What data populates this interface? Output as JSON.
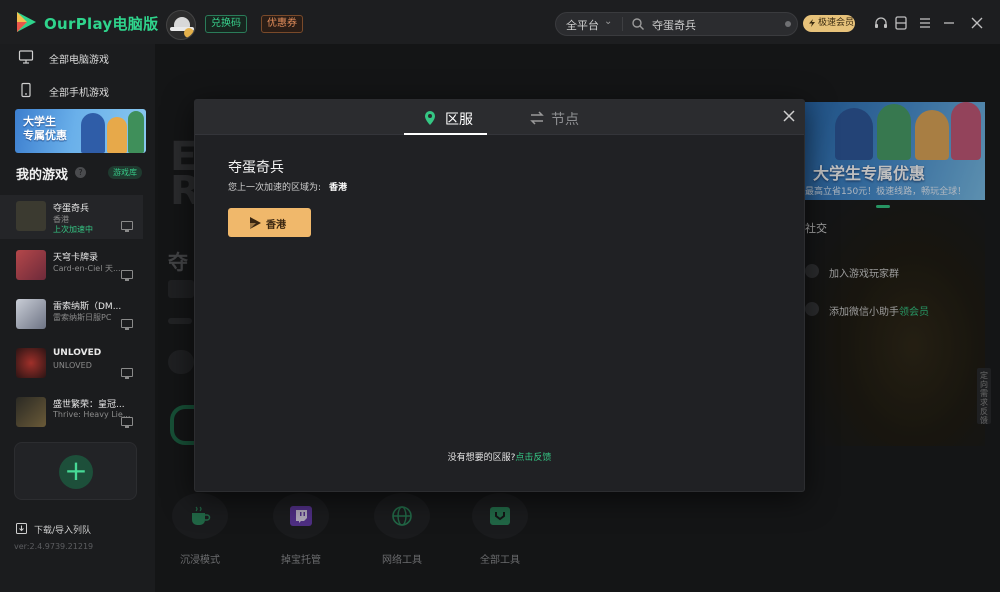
{
  "app": {
    "brand": "OurPlay电脑版",
    "chips": {
      "redeem": "兑换码",
      "coupon": "优惠券"
    },
    "search": {
      "platform": "全平台",
      "query": "夺蛋奇兵"
    },
    "vip_label": "极速会员"
  },
  "sidebar": {
    "nav": [
      {
        "label": "全部电脑游戏",
        "icon": "monitor-icon"
      },
      {
        "label": "全部手机游戏",
        "icon": "phone-icon"
      }
    ],
    "promo_text_line1": "大学生",
    "promo_text_line2": "专属优惠",
    "my_games_title": "我的游戏",
    "help_mark": "?",
    "game_lib": "游戏库",
    "games": [
      {
        "name": "夺蛋奇兵",
        "sub": "香港",
        "status": "上次加速中",
        "thumb": "#3b3a30"
      },
      {
        "name": "天穹卡牌录",
        "sub": "Card-en-Ciel 天...",
        "status": "",
        "thumb": "#b4474a"
      },
      {
        "name": "雷索纳斯（DM...",
        "sub": "雷索纳斯日服PC",
        "status": "",
        "thumb": "#c9cdd6"
      },
      {
        "name": "UNLOVED",
        "sub": "UNLOVED",
        "status": "",
        "thumb": "#3a1e1e"
      },
      {
        "name": "盛世繁荣：皇冠...",
        "sub": "Thrive: Heavy Lie...",
        "status": "",
        "thumb": "#2b2a24"
      }
    ],
    "add_symbol": "+",
    "download": "下载/导入列队",
    "version": "ver:2.4.9739.21219"
  },
  "background": {
    "banner_title": "大学生专属优惠",
    "banner_sub": "最高立省150元！极速线路，畅玩全球！",
    "social_title": "社交",
    "social_items": [
      {
        "text": "加入游戏玩家群",
        "highlight": ""
      },
      {
        "text": "添加微信小助手",
        "highlight": "领会员"
      }
    ],
    "side_tab": "定向需求反馈",
    "tools": [
      {
        "label": "沉浸模式",
        "icon": "cup-icon"
      },
      {
        "label": "掉宝托管",
        "icon": "twitch-icon"
      },
      {
        "label": "网络工具",
        "icon": "globe-icon"
      },
      {
        "label": "全部工具",
        "icon": "toolbox-icon"
      }
    ]
  },
  "modal": {
    "tabs": [
      {
        "label": "区服",
        "active": true,
        "icon": "location-pin-icon"
      },
      {
        "label": "节点",
        "active": false,
        "icon": "switch-arrows-icon"
      }
    ],
    "game_title": "夺蛋奇兵",
    "last_region_label": "您上一次加速的区域为:",
    "last_region_value": "香港",
    "region_button": "香港",
    "feedback_prefix": "没有想要的区服?",
    "feedback_link": "点击反馈"
  },
  "colors": {
    "accent": "#35c784",
    "region_button": "#f0b86b",
    "modal_bg": "#202124",
    "app_bg": "#1b1c1e"
  }
}
